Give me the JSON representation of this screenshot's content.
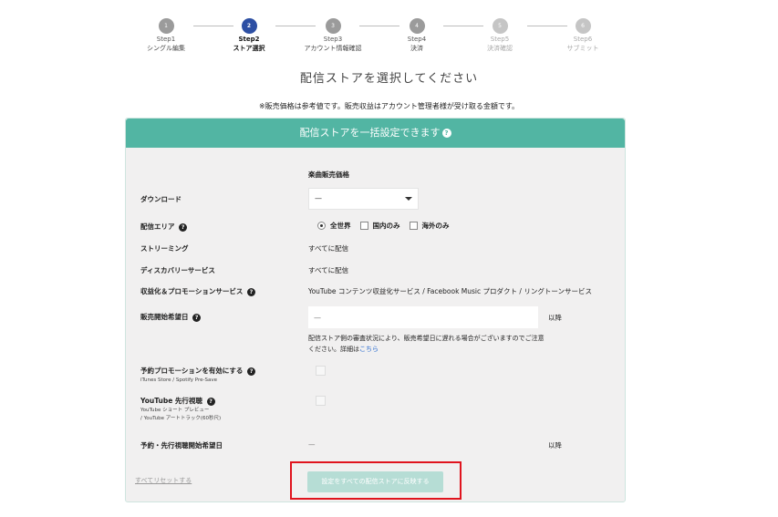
{
  "stepper": {
    "steps": [
      {
        "num": "1",
        "label": "Step1",
        "name": "シングル編集"
      },
      {
        "num": "2",
        "label": "Step2",
        "name": "ストア選択"
      },
      {
        "num": "3",
        "label": "Step3",
        "name": "アカウント情報確認"
      },
      {
        "num": "4",
        "label": "Step4",
        "name": "決済"
      },
      {
        "num": "5",
        "label": "Step5",
        "name": "決済確認"
      },
      {
        "num": "6",
        "label": "Step6",
        "name": "サブミット"
      }
    ]
  },
  "page": {
    "title": "配信ストアを選択してください",
    "notice": "※販売価格は参考値です。販売収益はアカウント管理者様が受け取る金額です。"
  },
  "panel": {
    "header": "配信ストアを一括設定できます",
    "column_header": "楽曲販売価格",
    "download": {
      "label": "ダウンロード",
      "value": "—"
    },
    "area": {
      "label": "配信エリア",
      "options": [
        "全世界",
        "国内のみ",
        "海外のみ"
      ]
    },
    "streaming": {
      "label": "ストリーミング",
      "value": "すべてに配信"
    },
    "discovery": {
      "label": "ディスカバリーサービス",
      "value": "すべてに配信"
    },
    "monetize": {
      "label": "収益化＆プロモーションサービス",
      "value": "YouTube コンテンツ収益化サービス / Facebook Music プロダクト / リングトーンサービス"
    },
    "release_date": {
      "label": "販売開始希望日",
      "placeholder": "—",
      "suffix": "以降",
      "note": "配信ストア側の審査状況により、販売希望日に遅れる場合がございますのでご注意ください。詳細は",
      "note_link": "こちら"
    },
    "preorder": {
      "label": "予約プロモーションを有効にする",
      "sub": "iTunes Store / Spotify Pre-Save"
    },
    "youtube_first": {
      "label": "YouTube 先行視聴",
      "sub1": "YouTube ショート プレビュー",
      "sub2": "/ YouTube アートトラック(60秒尺)"
    },
    "preorder_date": {
      "label": "予約・先行視聴開始希望日",
      "value": "—",
      "suffix": "以降"
    },
    "reset_link": "すべてリセットする",
    "apply_button": "設定をすべての配信ストアに反映する"
  }
}
